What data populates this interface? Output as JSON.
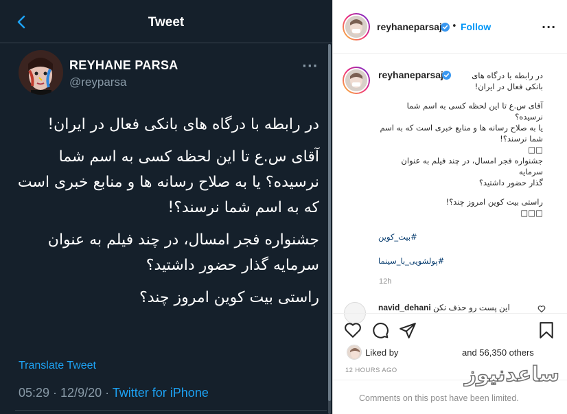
{
  "twitter": {
    "header_title": "Tweet",
    "display_name": "REYHANE PARSA",
    "handle": "@reyparsa",
    "more": "···",
    "body": [
      "در رابطه با درگاه های بانکی فعال در ایران!",
      "آقای س.ع تا این لحظه کسی به اسم شما نرسیده؟ یا به صلاح رسانه ها و منابع خبری است که به اسم شما نرسند؟!",
      "جشنواره فجر امسال، در چند فیلم به عنوان سرمایه گذار حضور داشتید؟",
      "راستی بیت کوین امروز چند؟"
    ],
    "translate_label": "Translate Tweet",
    "time": "05:29 · 12/9/20 · ",
    "source": "Twitter for iPhone"
  },
  "instagram": {
    "username": "reyhaneparsaj",
    "dot": "•",
    "follow_label": "Follow",
    "more": "···",
    "caption_head": "در رابطه با درگاه های",
    "caption_lines_1": [
      "بانکی فعال در ایران!"
    ],
    "caption_lines_2": [
      "آقای س.ع تا این لحظه کسی به اسم شما نرسیده؟",
      "یا به صلاح رسانه ها و منابع خبری است که به اسم",
      "شما نرسند؟!",
      "□□"
    ],
    "caption_lines_3": [
      "جشنواره فجر امسال، در چند فیلم به عنوان سرمایه",
      "گذار حضور داشتید؟"
    ],
    "caption_lines_4": [
      "راستی بیت کوین امروز چند؟!",
      "□□□"
    ],
    "hashtag_1": "#بیت_کوین",
    "hashtag_2": "#پولشویی_با_سینما",
    "time": "12h",
    "comment_user": "navid_dehani",
    "comment_text": "این پست رو حذف نکن",
    "liked_by": "Liked by",
    "others": "and 56,350 others",
    "ago": "12 HOURS AGO",
    "comments_disabled": "Comments on this post have been limited."
  },
  "watermark": "ساعدنیوز",
  "colors": {
    "twitter_bg": "#15202b",
    "twitter_accent": "#1da1f2",
    "instagram_link": "#0095f6"
  }
}
